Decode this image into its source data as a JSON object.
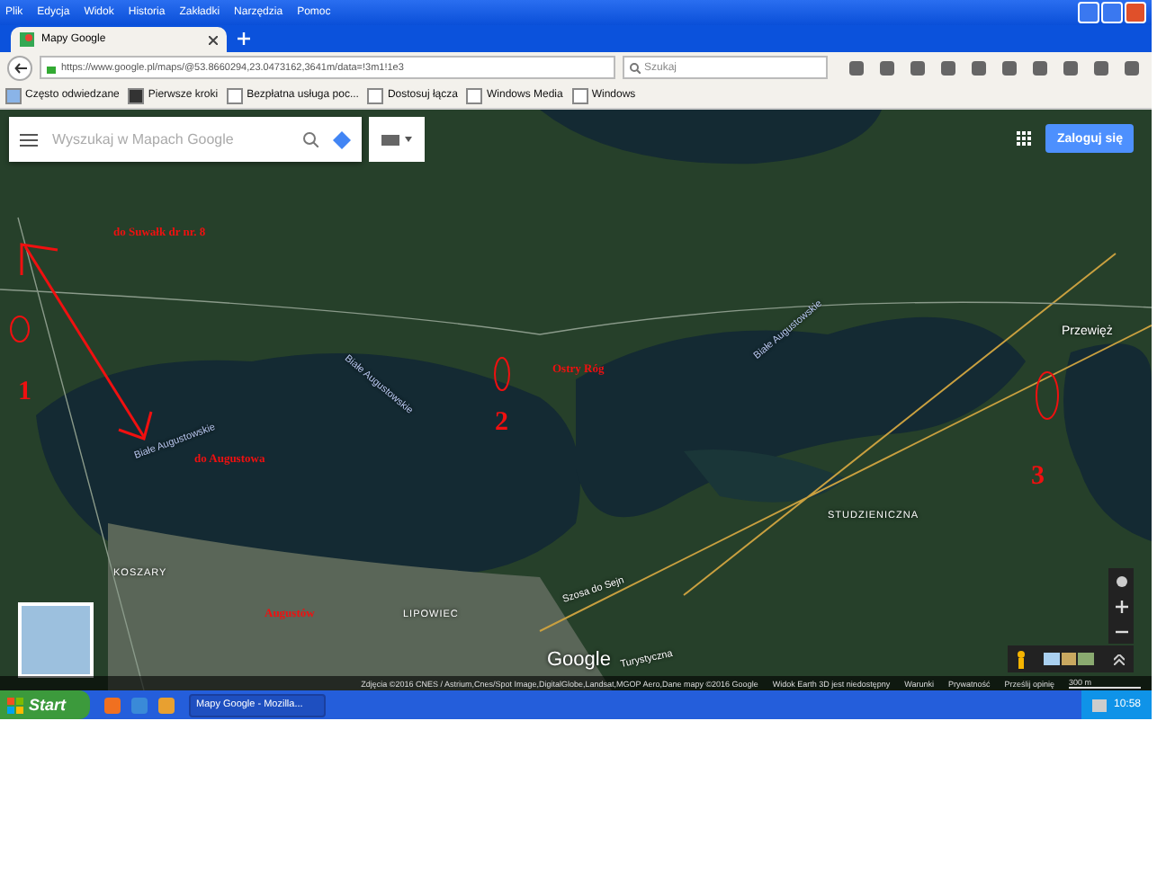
{
  "menu": [
    "Plik",
    "Edycja",
    "Widok",
    "Historia",
    "Zakładki",
    "Narzędzia",
    "Pomoc"
  ],
  "tabs": [
    {
      "label": "Mapy Google",
      "selected": true
    }
  ],
  "address_bar": {
    "value": "https://www.google.pl/maps/@53.8660294,23.0473162,3641m/data=!3m1!1e3"
  },
  "search": {
    "placeholder": "Szukaj"
  },
  "bookmarks": [
    {
      "label": "Często odwiedzane",
      "kind": "folder"
    },
    {
      "label": "Pierwsze kroki",
      "kind": "brand"
    },
    {
      "label": "Bezpłatna usługa poc...",
      "kind": "page"
    },
    {
      "label": "Dostosuj łącza",
      "kind": "page"
    },
    {
      "label": "Windows Media",
      "kind": "page"
    },
    {
      "label": "Windows",
      "kind": "page"
    }
  ],
  "map_search": {
    "placeholder": "Wyszukaj w Mapach Google"
  },
  "sign_in": "Zaloguj się",
  "map_labels": [
    {
      "text": "Białe Augustowskie",
      "kind": "water"
    },
    {
      "text": "Białe Augustowskie",
      "kind": "water"
    },
    {
      "text": "Białe Augustowskie",
      "kind": "water"
    },
    {
      "text": "Przewięż",
      "kind": "place"
    },
    {
      "text": "STUDZIENICZNA",
      "kind": "district"
    },
    {
      "text": "Szosa do Sejn",
      "kind": "road"
    },
    {
      "text": "KOSZARY",
      "kind": "district"
    },
    {
      "text": "LIPOWIEC",
      "kind": "district"
    },
    {
      "text": "Turystyczna",
      "kind": "road"
    }
  ],
  "annotations": [
    {
      "text": "do Suwałk dr nr. 8",
      "kind": "label"
    },
    {
      "text": "Ostry Róg",
      "kind": "label"
    },
    {
      "text": "do Augustowa",
      "kind": "label"
    },
    {
      "text": "Augustów",
      "kind": "label"
    },
    {
      "text": "1",
      "kind": "number"
    },
    {
      "text": "2",
      "kind": "number"
    },
    {
      "text": "3",
      "kind": "number"
    }
  ],
  "google_logo": "Google",
  "attribution": [
    "Zdjęcia ©2016 CNES / Astrium,Cnes/Spot Image,DigitalGlobe,Landsat,MGOP Aero,Dane mapy ©2016 Google",
    "Widok Earth 3D jest niedostępny",
    "Warunki",
    "Prywatność",
    "Prześlij opinię"
  ],
  "scale": "300 m",
  "taskbar": {
    "start": "Start",
    "windows": [
      {
        "label": "Mapy Google - Mozilla...",
        "selected": true
      }
    ],
    "clock": "10:58"
  }
}
